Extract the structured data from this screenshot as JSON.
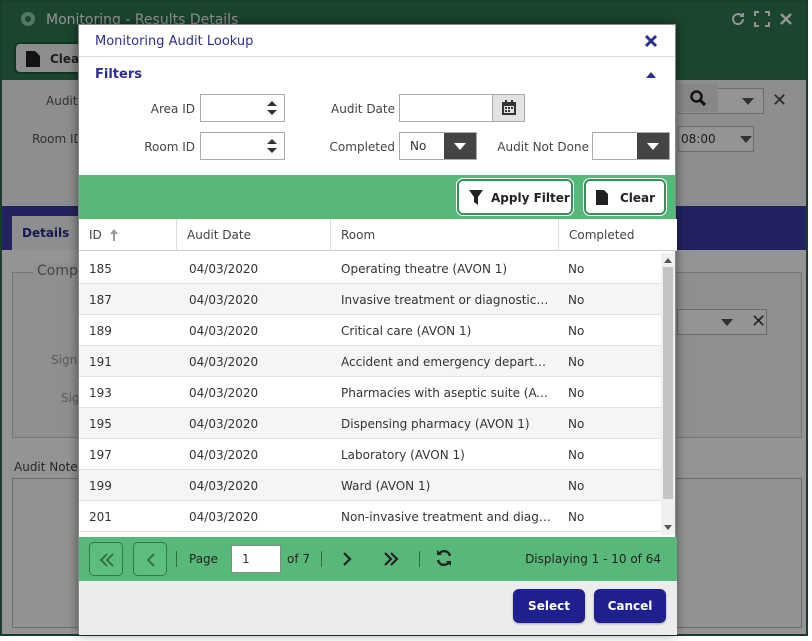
{
  "background": {
    "title": "Monitoring - Results Details",
    "toolbar_clear": "Clear",
    "labels": {
      "audit": "Audit",
      "room_id": "Room ID",
      "time": "08:00"
    },
    "tab_details": "Details",
    "section_title": "Comple",
    "sign1": "Sign",
    "sign2": "Sig",
    "notes_label": "Audit Notes"
  },
  "modal": {
    "title": "Monitoring Audit Lookup",
    "filters": {
      "title": "Filters",
      "area_id_label": "Area ID",
      "area_id_value": "",
      "audit_date_label": "Audit Date",
      "audit_date_value": "",
      "room_id_label": "Room ID",
      "room_id_value": "",
      "completed_label": "Completed",
      "completed_value": "No",
      "audit_not_done_label": "Audit Not Done",
      "audit_not_done_value": ""
    },
    "actions": {
      "apply_filter": "Apply Filter",
      "clear": "Clear"
    },
    "grid": {
      "columns": [
        "ID",
        "Audit Date",
        "Room",
        "Completed"
      ],
      "rows": [
        {
          "id": "185",
          "date": "04/03/2020",
          "room": "Operating theatre (AVON 1)",
          "completed": "No"
        },
        {
          "id": "187",
          "date": "04/03/2020",
          "room": "Invasive treatment or diagnostic de...",
          "completed": "No"
        },
        {
          "id": "189",
          "date": "04/03/2020",
          "room": "Critical care (AVON 1)",
          "completed": "No"
        },
        {
          "id": "191",
          "date": "04/03/2020",
          "room": "Accident and emergency departme...",
          "completed": "No"
        },
        {
          "id": "193",
          "date": "04/03/2020",
          "room": "Pharmacies with aseptic suite (AVO...",
          "completed": "No"
        },
        {
          "id": "195",
          "date": "04/03/2020",
          "room": "Dispensing pharmacy (AVON 1)",
          "completed": "No"
        },
        {
          "id": "197",
          "date": "04/03/2020",
          "room": "Laboratory (AVON 1)",
          "completed": "No"
        },
        {
          "id": "199",
          "date": "04/03/2020",
          "room": "Ward (AVON 1)",
          "completed": "No"
        },
        {
          "id": "201",
          "date": "04/03/2020",
          "room": "Non-invasive treatment and diagno...",
          "completed": "No"
        }
      ]
    },
    "pager": {
      "page_label": "Page",
      "page_value": "1",
      "of_label": "of 7",
      "display": "Displaying 1 - 10 of 64"
    },
    "footer": {
      "select": "Select",
      "cancel": "Cancel"
    }
  },
  "colors": {
    "green_bar": "#58b879",
    "title_blue": "#2e2e8e",
    "button_navy": "#1f1f8f",
    "header_green": "#2f7750"
  }
}
